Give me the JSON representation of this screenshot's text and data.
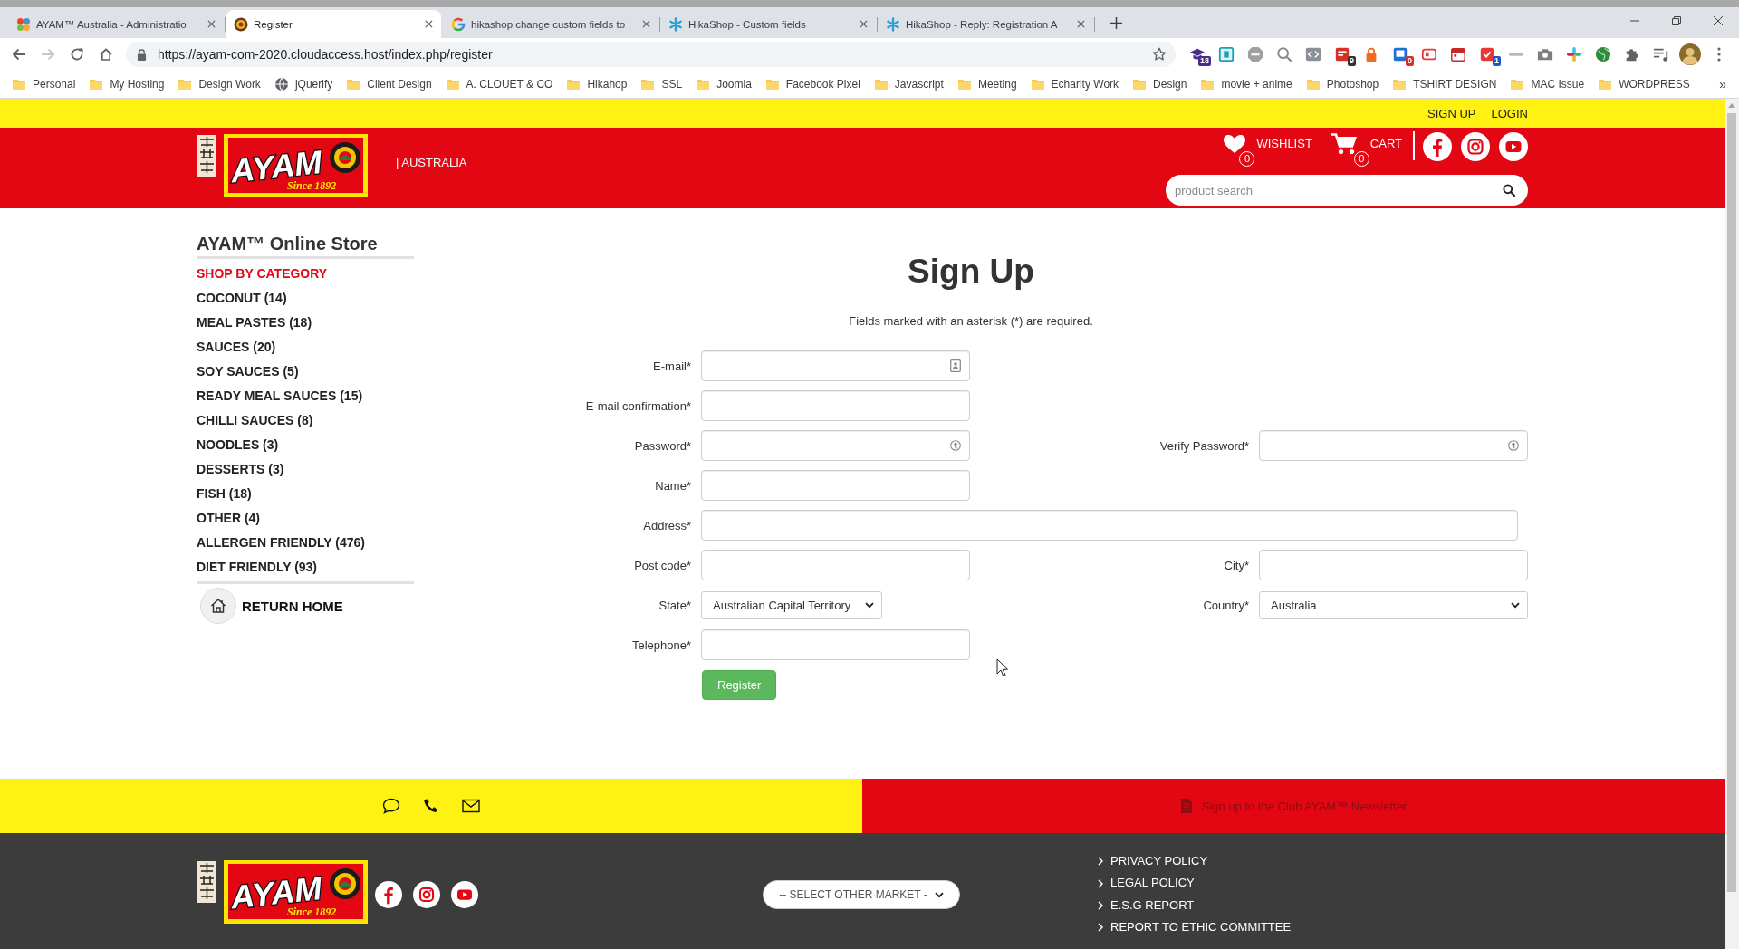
{
  "browser": {
    "tabs": [
      {
        "title": "AYAM™ Australia - Administratio",
        "selected": false
      },
      {
        "title": "Register",
        "selected": true
      },
      {
        "title": "hikashop change custom fields to",
        "selected": false
      },
      {
        "title": "HikaShop - Custom fields",
        "selected": false
      },
      {
        "title": "HikaShop - Reply: Registration A",
        "selected": false
      }
    ],
    "history": {
      "back_disabled": false,
      "forward_disabled": true
    },
    "address": "https://ayam-com-2020.cloudaccess.host/index.php/register",
    "extension_badges": [
      "18",
      "9",
      "0",
      "1"
    ],
    "bookmarks": [
      {
        "label": "Personal",
        "kind": "folder"
      },
      {
        "label": "My Hosting",
        "kind": "folder"
      },
      {
        "label": "Design Work",
        "kind": "folder"
      },
      {
        "label": "jQuerify",
        "kind": "site"
      },
      {
        "label": "Client Design",
        "kind": "folder"
      },
      {
        "label": "A. CLOUET & CO",
        "kind": "folder"
      },
      {
        "label": "Hikahop",
        "kind": "folder"
      },
      {
        "label": "SSL",
        "kind": "folder"
      },
      {
        "label": "Joomla",
        "kind": "folder"
      },
      {
        "label": "Facebook Pixel",
        "kind": "folder"
      },
      {
        "label": "Javascript",
        "kind": "folder"
      },
      {
        "label": "Meeting",
        "kind": "folder"
      },
      {
        "label": "Echarity Work",
        "kind": "folder"
      },
      {
        "label": "Design",
        "kind": "folder"
      },
      {
        "label": "movie + anime",
        "kind": "folder"
      },
      {
        "label": "Photoshop",
        "kind": "folder"
      },
      {
        "label": "TSHIRT DESIGN",
        "kind": "folder"
      },
      {
        "label": "MAC Issue",
        "kind": "folder"
      },
      {
        "label": "WORDPRESS",
        "kind": "folder"
      }
    ],
    "bookmarks_overflow": "»"
  },
  "top_bar": {
    "links": [
      "SIGN UP",
      "LOGIN"
    ]
  },
  "header": {
    "logo": {
      "wordmark": "AYAM",
      "tagline": "Since 1892"
    },
    "region": "| AUSTRALIA",
    "wishlist": {
      "label": "WISHLIST",
      "count": "0"
    },
    "cart": {
      "label": "CART",
      "count": "0"
    },
    "search": {
      "placeholder": "product search"
    }
  },
  "sidebar": {
    "title": "AYAM™ Online Store",
    "heading": "SHOP BY CATEGORY",
    "categories": [
      "COCONUT (14)",
      "MEAL PASTES (18)",
      "SAUCES (20)",
      "SOY SAUCES (5)",
      "READY MEAL SAUCES (15)",
      "CHILLI SAUCES (8)",
      "NOODLES (3)",
      "DESSERTS (3)",
      "FISH (18)",
      "OTHER (4)",
      "ALLERGEN FRIENDLY (476)",
      "DIET FRIENDLY (93)"
    ],
    "return_home": "RETURN HOME"
  },
  "form": {
    "title": "Sign Up",
    "note": "Fields marked with an asterisk (*) are required.",
    "rows": [
      {
        "fields": [
          {
            "label": "E-mail*",
            "kind": "email",
            "wide": false
          }
        ]
      },
      {
        "fields": [
          {
            "label": "E-mail confirmation*",
            "kind": "text",
            "wide": false
          }
        ]
      },
      {
        "fields": [
          {
            "label": "Password*",
            "kind": "password",
            "wide": false
          },
          {
            "label": "Verify Password*",
            "kind": "password",
            "wide": false
          }
        ]
      },
      {
        "fields": [
          {
            "label": "Name*",
            "kind": "text",
            "wide": false
          }
        ]
      },
      {
        "fields": [
          {
            "label": "Address*",
            "kind": "text",
            "wide": true
          }
        ]
      },
      {
        "fields": [
          {
            "label": "Post code*",
            "kind": "text",
            "wide": false
          },
          {
            "label": "City*",
            "kind": "text",
            "wide": false
          }
        ]
      },
      {
        "fields": [
          {
            "label": "State*",
            "kind": "select",
            "value": "Australian Capital Territory",
            "wide": false
          },
          {
            "label": "Country*",
            "kind": "select",
            "value": "Australia",
            "wide": false
          }
        ]
      },
      {
        "fields": [
          {
            "label": "Telephone*",
            "kind": "text",
            "wide": false
          }
        ]
      }
    ],
    "submit": "Register"
  },
  "footer": {
    "newsletter": "Sign up to the Club AYAM™ Newsletter",
    "logo": {
      "wordmark": "AYAM",
      "tagline": "Since 1892"
    },
    "market_select": {
      "value": "-- SELECT OTHER MARKET -"
    },
    "links": [
      "PRIVACY POLICY",
      "LEGAL POLICY",
      "E.S.G REPORT",
      "REPORT TO ETHIC COMMITTEE"
    ]
  }
}
